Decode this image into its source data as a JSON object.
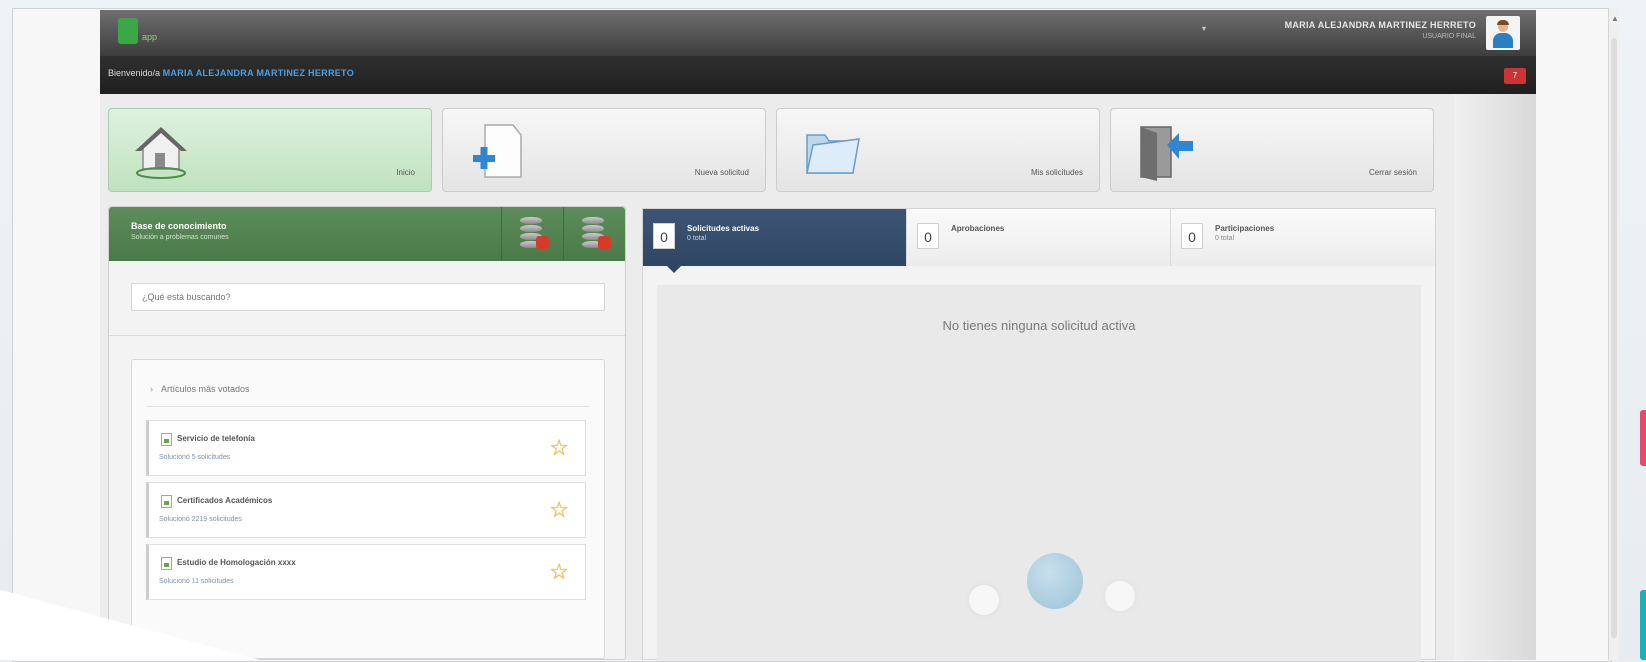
{
  "app": {
    "logo_text": "app"
  },
  "header": {
    "user_name": "MARIA ALEJANDRA MARTINEZ HERRETO",
    "user_role": "USUARIO FINAL",
    "welcome_prefix": "Bienvenido/a",
    "welcome_name": "MARIA ALEJANDRA MARTINEZ HERRETO",
    "notification_badge": "7"
  },
  "tiles": [
    {
      "label": "Inicio",
      "icon": "home-icon"
    },
    {
      "label": "Nueva solicitud",
      "icon": "new-document-icon"
    },
    {
      "label": "Mis solicitudes",
      "icon": "folder-icon"
    },
    {
      "label": "Cerrar sesión",
      "icon": "logout-icon"
    }
  ],
  "knowledge_base": {
    "title": "Base de conocimiento",
    "subtitle": "Solución a problemas comunes",
    "search_placeholder": "¿Qué está buscando?",
    "articles_header": "Artículos más votados",
    "articles": [
      {
        "title": "Servicio de telefonía",
        "subtitle": "Solucionó 5 solicitudes"
      },
      {
        "title": "Certificados Académicos",
        "subtitle": "Solucionó 2219 solicitudes"
      },
      {
        "title": "Estudio de Homologación xxxx",
        "subtitle": "Solucionó 11 solicitudes"
      }
    ]
  },
  "requests": {
    "tabs": [
      {
        "count": "0",
        "title": "Solicitudes activas",
        "subtitle": "0 total"
      },
      {
        "count": "0",
        "title": "Aprobaciones",
        "subtitle": ""
      },
      {
        "count": "0",
        "title": "Participaciones",
        "subtitle": "0 total"
      }
    ],
    "empty_message": "No tienes ninguna solicitud activa"
  },
  "colors": {
    "header_dark": "#3d3d3d",
    "kb_green": "#4a7a48",
    "tab_active": "#2f4564",
    "tile_active": "#bfe2bf",
    "username_blue": "#4aa0e8"
  }
}
